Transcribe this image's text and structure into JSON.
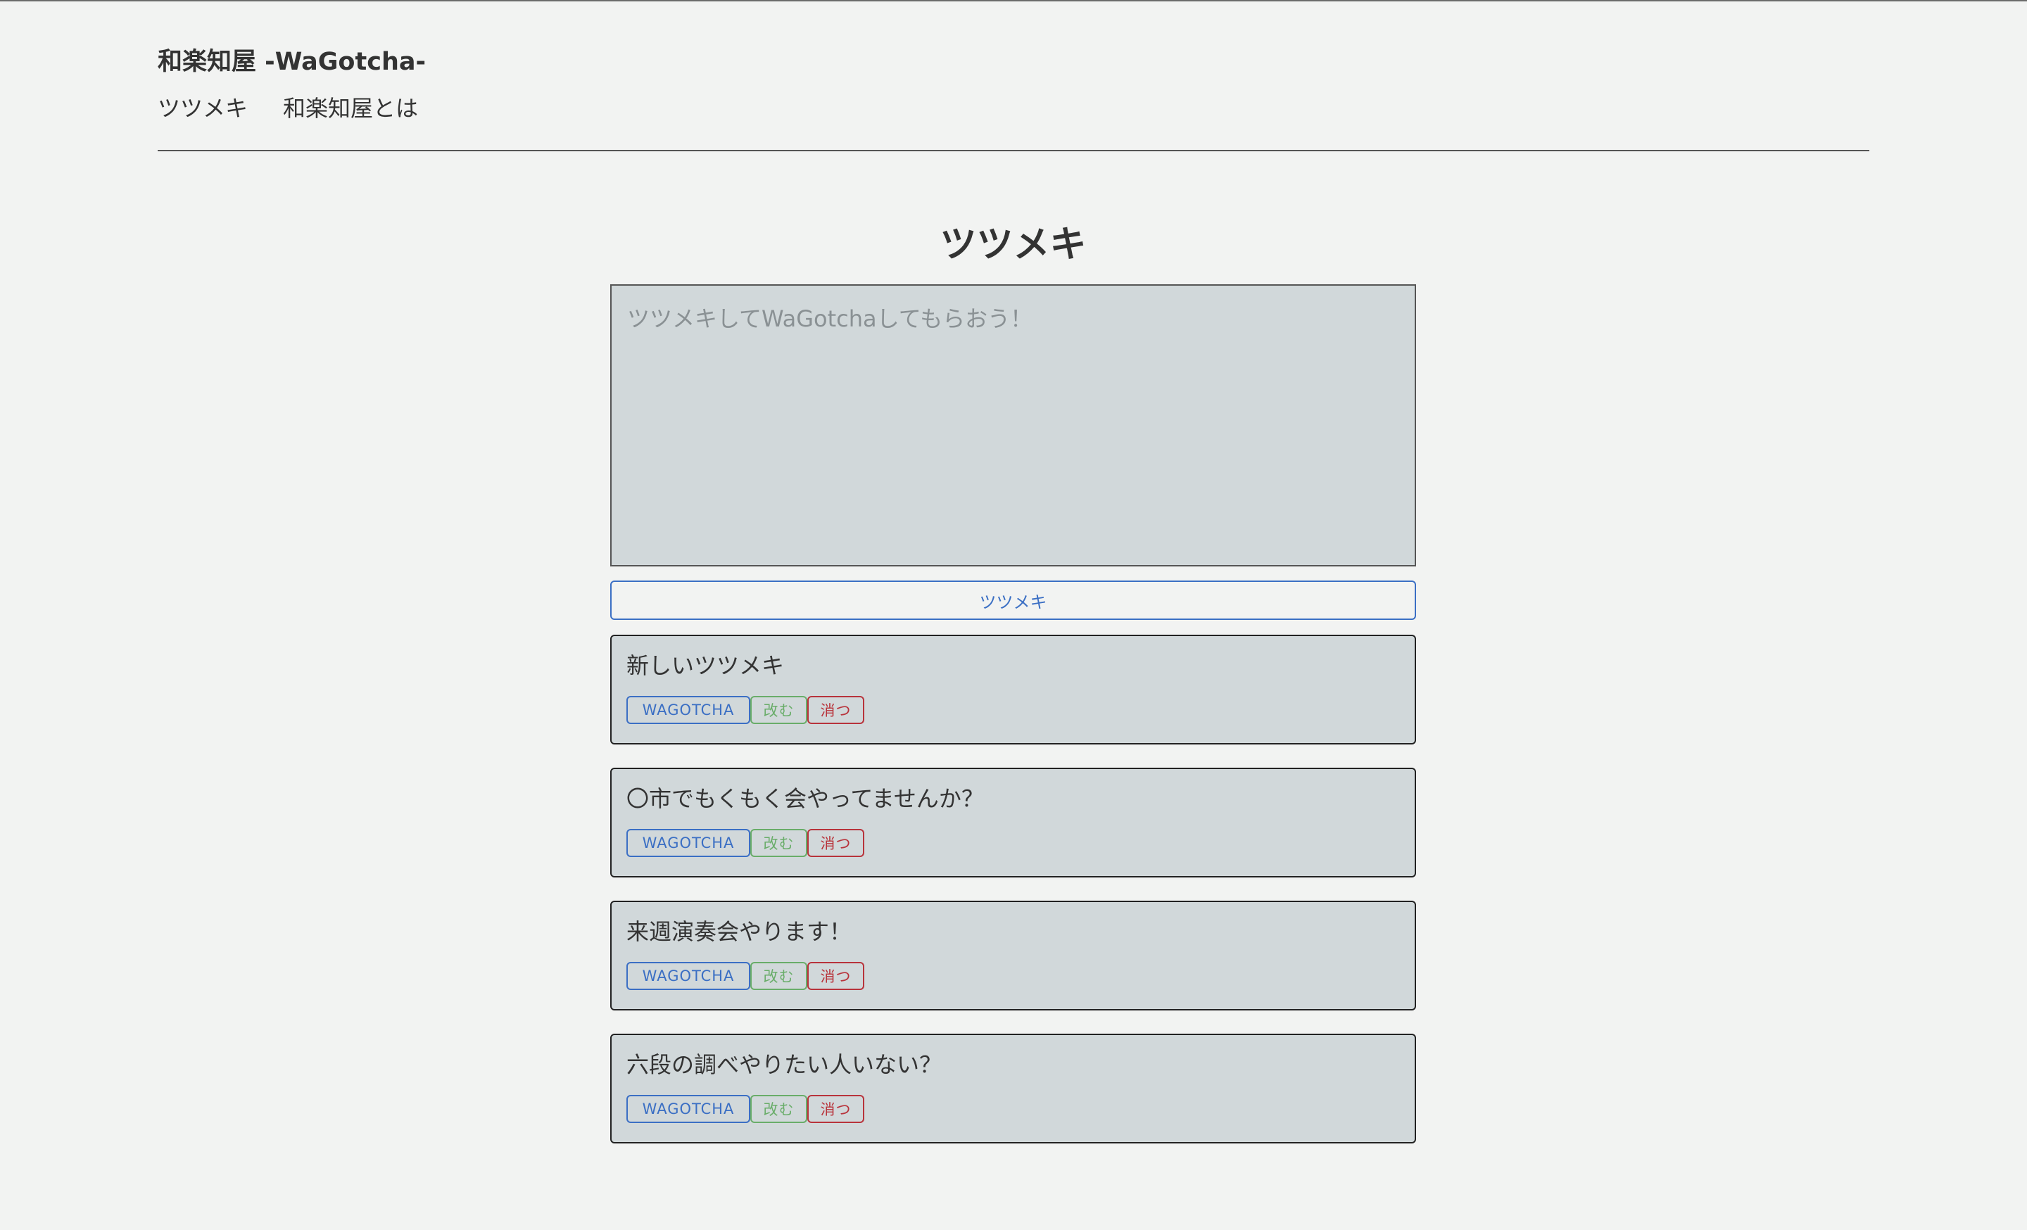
{
  "header": {
    "site_title": "和楽知屋 -WaGotcha-",
    "nav": [
      {
        "label": "ツツメキ"
      },
      {
        "label": "和楽知屋とは"
      }
    ]
  },
  "main": {
    "title": "ツツメキ",
    "compose_placeholder": "ツツメキしてWaGotchaしてもらおう！",
    "compose_value": "",
    "submit_label": "ツツメキ",
    "action_labels": {
      "wagotcha": "WAGOTCHA",
      "edit": "改む",
      "delete": "消つ"
    },
    "posts": [
      {
        "text": "新しいツツメキ"
      },
      {
        "text": "〇市でもくもく会やってませんか？"
      },
      {
        "text": "来週演奏会やります！"
      },
      {
        "text": "六段の調べやりたい人いない？"
      }
    ]
  },
  "colors": {
    "background": "#f2f3f2",
    "card": "#d1d8da",
    "primary": "#3b6fc4",
    "success": "#69ad69",
    "danger": "#b8333b"
  }
}
